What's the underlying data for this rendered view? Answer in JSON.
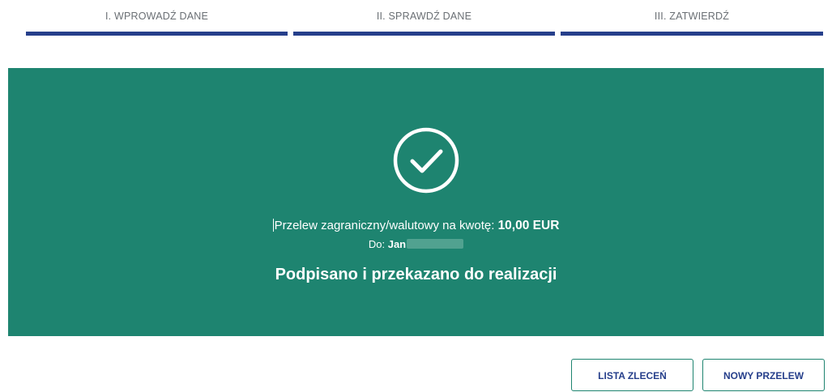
{
  "steps": [
    {
      "label": "I. WPROWADŹ DANE"
    },
    {
      "label": "II. SPRAWDŹ DANE"
    },
    {
      "label": "III. ZATWIERDŹ"
    }
  ],
  "colors": {
    "panel": "#1e8470",
    "step_bar": "#263f8b",
    "button_text": "#263f8b"
  },
  "confirmation": {
    "icon": "check-circle-icon",
    "transfer_label": "Przelew zagraniczny/walutowy na kwotę: ",
    "amount": "10,00 EUR",
    "recipient_label": "Do: ",
    "recipient_name": "Jan",
    "status": "Podpisano i przekazano do realizacji"
  },
  "actions": {
    "order_list": "LISTA ZLECEŃ",
    "new_transfer": "NOWY PRZELEW"
  }
}
